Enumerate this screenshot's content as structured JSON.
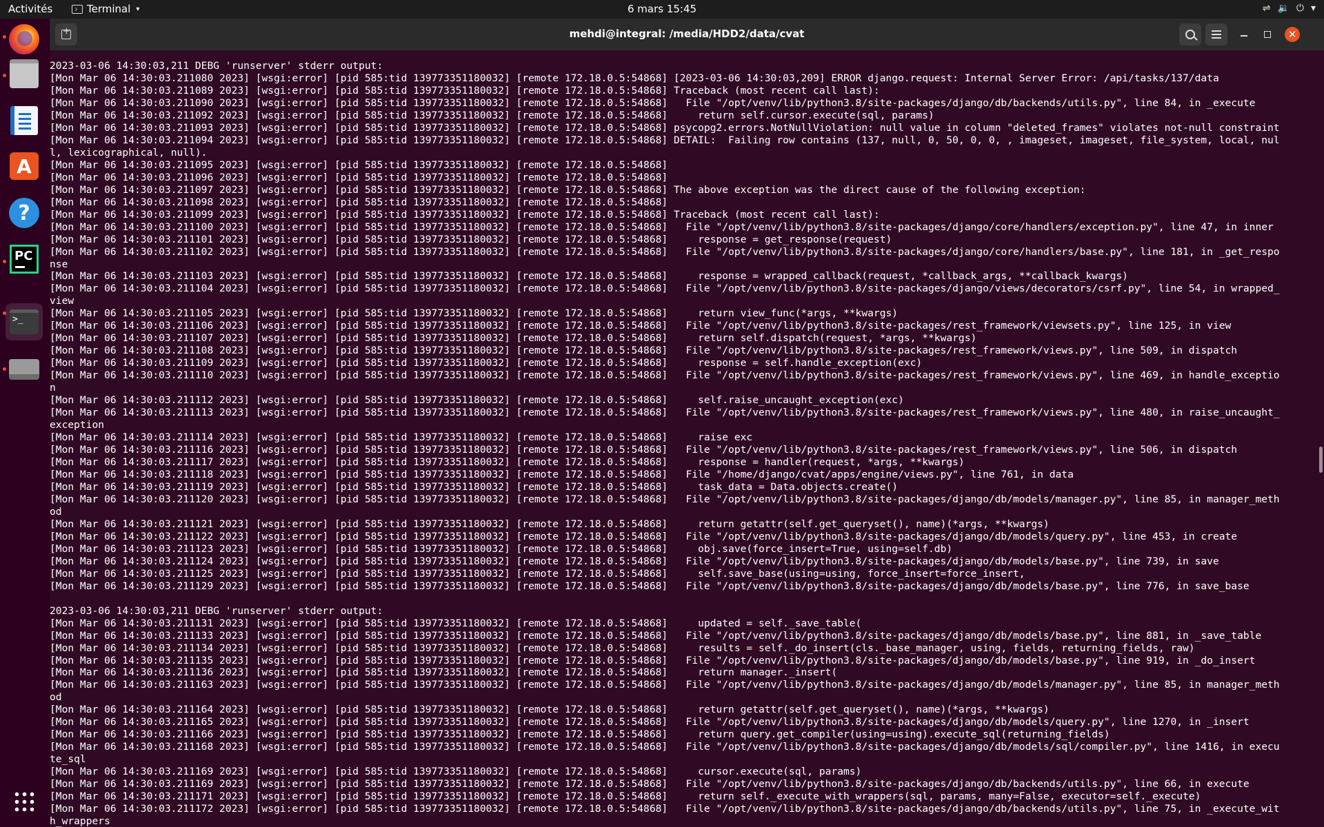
{
  "topbar": {
    "activities": "Activités",
    "app_name": "Terminal",
    "clock": "6 mars  15:45",
    "status_icons": [
      "network-icon",
      "volume-icon",
      "power-icon"
    ]
  },
  "dock": {
    "items": [
      "firefox",
      "files",
      "libreoffice-writer",
      "ubuntu-software",
      "help",
      "pycharm",
      "terminal",
      "drive",
      "show-applications"
    ]
  },
  "window": {
    "title": "mehdi@integral: /media/HDD2/data/cvat"
  },
  "terminal": {
    "lines": [
      "2023-03-06 14:30:03,211 DEBG 'runserver' stderr output:",
      "[Mon Mar 06 14:30:03.211080 2023] [wsgi:error] [pid 585:tid 139773351180032] [remote 172.18.0.5:54868] [2023-03-06 14:30:03,209] ERROR django.request: Internal Server Error: /api/tasks/137/data",
      "[Mon Mar 06 14:30:03.211089 2023] [wsgi:error] [pid 585:tid 139773351180032] [remote 172.18.0.5:54868] Traceback (most recent call last):",
      "[Mon Mar 06 14:30:03.211090 2023] [wsgi:error] [pid 585:tid 139773351180032] [remote 172.18.0.5:54868]   File \"/opt/venv/lib/python3.8/site-packages/django/db/backends/utils.py\", line 84, in _execute",
      "[Mon Mar 06 14:30:03.211092 2023] [wsgi:error] [pid 585:tid 139773351180032] [remote 172.18.0.5:54868]     return self.cursor.execute(sql, params)",
      "[Mon Mar 06 14:30:03.211093 2023] [wsgi:error] [pid 585:tid 139773351180032] [remote 172.18.0.5:54868] psycopg2.errors.NotNullViolation: null value in column \"deleted_frames\" violates not-null constraint",
      "[Mon Mar 06 14:30:03.211094 2023] [wsgi:error] [pid 585:tid 139773351180032] [remote 172.18.0.5:54868] DETAIL:  Failing row contains (137, null, 0, 50, 0, 0, , imageset, imageset, file_system, local, nul",
      "l, lexicographical, null).",
      "[Mon Mar 06 14:30:03.211095 2023] [wsgi:error] [pid 585:tid 139773351180032] [remote 172.18.0.5:54868]",
      "[Mon Mar 06 14:30:03.211096 2023] [wsgi:error] [pid 585:tid 139773351180032] [remote 172.18.0.5:54868]",
      "[Mon Mar 06 14:30:03.211097 2023] [wsgi:error] [pid 585:tid 139773351180032] [remote 172.18.0.5:54868] The above exception was the direct cause of the following exception:",
      "[Mon Mar 06 14:30:03.211098 2023] [wsgi:error] [pid 585:tid 139773351180032] [remote 172.18.0.5:54868]",
      "[Mon Mar 06 14:30:03.211099 2023] [wsgi:error] [pid 585:tid 139773351180032] [remote 172.18.0.5:54868] Traceback (most recent call last):",
      "[Mon Mar 06 14:30:03.211100 2023] [wsgi:error] [pid 585:tid 139773351180032] [remote 172.18.0.5:54868]   File \"/opt/venv/lib/python3.8/site-packages/django/core/handlers/exception.py\", line 47, in inner",
      "[Mon Mar 06 14:30:03.211101 2023] [wsgi:error] [pid 585:tid 139773351180032] [remote 172.18.0.5:54868]     response = get_response(request)",
      "[Mon Mar 06 14:30:03.211102 2023] [wsgi:error] [pid 585:tid 139773351180032] [remote 172.18.0.5:54868]   File \"/opt/venv/lib/python3.8/site-packages/django/core/handlers/base.py\", line 181, in _get_respo",
      "nse",
      "[Mon Mar 06 14:30:03.211103 2023] [wsgi:error] [pid 585:tid 139773351180032] [remote 172.18.0.5:54868]     response = wrapped_callback(request, *callback_args, **callback_kwargs)",
      "[Mon Mar 06 14:30:03.211104 2023] [wsgi:error] [pid 585:tid 139773351180032] [remote 172.18.0.5:54868]   File \"/opt/venv/lib/python3.8/site-packages/django/views/decorators/csrf.py\", line 54, in wrapped_",
      "view",
      "[Mon Mar 06 14:30:03.211105 2023] [wsgi:error] [pid 585:tid 139773351180032] [remote 172.18.0.5:54868]     return view_func(*args, **kwargs)",
      "[Mon Mar 06 14:30:03.211106 2023] [wsgi:error] [pid 585:tid 139773351180032] [remote 172.18.0.5:54868]   File \"/opt/venv/lib/python3.8/site-packages/rest_framework/viewsets.py\", line 125, in view",
      "[Mon Mar 06 14:30:03.211107 2023] [wsgi:error] [pid 585:tid 139773351180032] [remote 172.18.0.5:54868]     return self.dispatch(request, *args, **kwargs)",
      "[Mon Mar 06 14:30:03.211108 2023] [wsgi:error] [pid 585:tid 139773351180032] [remote 172.18.0.5:54868]   File \"/opt/venv/lib/python3.8/site-packages/rest_framework/views.py\", line 509, in dispatch",
      "[Mon Mar 06 14:30:03.211109 2023] [wsgi:error] [pid 585:tid 139773351180032] [remote 172.18.0.5:54868]     response = self.handle_exception(exc)",
      "[Mon Mar 06 14:30:03.211110 2023] [wsgi:error] [pid 585:tid 139773351180032] [remote 172.18.0.5:54868]   File \"/opt/venv/lib/python3.8/site-packages/rest_framework/views.py\", line 469, in handle_exceptio",
      "n",
      "[Mon Mar 06 14:30:03.211112 2023] [wsgi:error] [pid 585:tid 139773351180032] [remote 172.18.0.5:54868]     self.raise_uncaught_exception(exc)",
      "[Mon Mar 06 14:30:03.211113 2023] [wsgi:error] [pid 585:tid 139773351180032] [remote 172.18.0.5:54868]   File \"/opt/venv/lib/python3.8/site-packages/rest_framework/views.py\", line 480, in raise_uncaught_",
      "exception",
      "[Mon Mar 06 14:30:03.211114 2023] [wsgi:error] [pid 585:tid 139773351180032] [remote 172.18.0.5:54868]     raise exc",
      "[Mon Mar 06 14:30:03.211116 2023] [wsgi:error] [pid 585:tid 139773351180032] [remote 172.18.0.5:54868]   File \"/opt/venv/lib/python3.8/site-packages/rest_framework/views.py\", line 506, in dispatch",
      "[Mon Mar 06 14:30:03.211117 2023] [wsgi:error] [pid 585:tid 139773351180032] [remote 172.18.0.5:54868]     response = handler(request, *args, **kwargs)",
      "[Mon Mar 06 14:30:03.211118 2023] [wsgi:error] [pid 585:tid 139773351180032] [remote 172.18.0.5:54868]   File \"/home/django/cvat/apps/engine/views.py\", line 761, in data",
      "[Mon Mar 06 14:30:03.211119 2023] [wsgi:error] [pid 585:tid 139773351180032] [remote 172.18.0.5:54868]     task_data = Data.objects.create()",
      "[Mon Mar 06 14:30:03.211120 2023] [wsgi:error] [pid 585:tid 139773351180032] [remote 172.18.0.5:54868]   File \"/opt/venv/lib/python3.8/site-packages/django/db/models/manager.py\", line 85, in manager_meth",
      "od",
      "[Mon Mar 06 14:30:03.211121 2023] [wsgi:error] [pid 585:tid 139773351180032] [remote 172.18.0.5:54868]     return getattr(self.get_queryset(), name)(*args, **kwargs)",
      "[Mon Mar 06 14:30:03.211122 2023] [wsgi:error] [pid 585:tid 139773351180032] [remote 172.18.0.5:54868]   File \"/opt/venv/lib/python3.8/site-packages/django/db/models/query.py\", line 453, in create",
      "[Mon Mar 06 14:30:03.211123 2023] [wsgi:error] [pid 585:tid 139773351180032] [remote 172.18.0.5:54868]     obj.save(force_insert=True, using=self.db)",
      "[Mon Mar 06 14:30:03.211124 2023] [wsgi:error] [pid 585:tid 139773351180032] [remote 172.18.0.5:54868]   File \"/opt/venv/lib/python3.8/site-packages/django/db/models/base.py\", line 739, in save",
      "[Mon Mar 06 14:30:03.211125 2023] [wsgi:error] [pid 585:tid 139773351180032] [remote 172.18.0.5:54868]     self.save_base(using=using, force_insert=force_insert,",
      "[Mon Mar 06 14:30:03.211129 2023] [wsgi:error] [pid 585:tid 139773351180032] [remote 172.18.0.5:54868]   File \"/opt/venv/lib/python3.8/site-packages/django/db/models/base.py\", line 776, in save_base",
      "",
      "2023-03-06 14:30:03,211 DEBG 'runserver' stderr output:",
      "[Mon Mar 06 14:30:03.211131 2023] [wsgi:error] [pid 585:tid 139773351180032] [remote 172.18.0.5:54868]     updated = self._save_table(",
      "[Mon Mar 06 14:30:03.211133 2023] [wsgi:error] [pid 585:tid 139773351180032] [remote 172.18.0.5:54868]   File \"/opt/venv/lib/python3.8/site-packages/django/db/models/base.py\", line 881, in _save_table",
      "[Mon Mar 06 14:30:03.211134 2023] [wsgi:error] [pid 585:tid 139773351180032] [remote 172.18.0.5:54868]     results = self._do_insert(cls._base_manager, using, fields, returning_fields, raw)",
      "[Mon Mar 06 14:30:03.211135 2023] [wsgi:error] [pid 585:tid 139773351180032] [remote 172.18.0.5:54868]   File \"/opt/venv/lib/python3.8/site-packages/django/db/models/base.py\", line 919, in _do_insert",
      "[Mon Mar 06 14:30:03.211136 2023] [wsgi:error] [pid 585:tid 139773351180032] [remote 172.18.0.5:54868]     return manager._insert(",
      "[Mon Mar 06 14:30:03.211163 2023] [wsgi:error] [pid 585:tid 139773351180032] [remote 172.18.0.5:54868]   File \"/opt/venv/lib/python3.8/site-packages/django/db/models/manager.py\", line 85, in manager_meth",
      "od",
      "[Mon Mar 06 14:30:03.211164 2023] [wsgi:error] [pid 585:tid 139773351180032] [remote 172.18.0.5:54868]     return getattr(self.get_queryset(), name)(*args, **kwargs)",
      "[Mon Mar 06 14:30:03.211165 2023] [wsgi:error] [pid 585:tid 139773351180032] [remote 172.18.0.5:54868]   File \"/opt/venv/lib/python3.8/site-packages/django/db/models/query.py\", line 1270, in _insert",
      "[Mon Mar 06 14:30:03.211166 2023] [wsgi:error] [pid 585:tid 139773351180032] [remote 172.18.0.5:54868]     return query.get_compiler(using=using).execute_sql(returning_fields)",
      "[Mon Mar 06 14:30:03.211168 2023] [wsgi:error] [pid 585:tid 139773351180032] [remote 172.18.0.5:54868]   File \"/opt/venv/lib/python3.8/site-packages/django/db/models/sql/compiler.py\", line 1416, in execu",
      "te_sql",
      "[Mon Mar 06 14:30:03.211169 2023] [wsgi:error] [pid 585:tid 139773351180032] [remote 172.18.0.5:54868]     cursor.execute(sql, params)",
      "[Mon Mar 06 14:30:03.211169 2023] [wsgi:error] [pid 585:tid 139773351180032] [remote 172.18.0.5:54868]   File \"/opt/venv/lib/python3.8/site-packages/django/db/backends/utils.py\", line 66, in execute",
      "[Mon Mar 06 14:30:03.211171 2023] [wsgi:error] [pid 585:tid 139773351180032] [remote 172.18.0.5:54868]     return self._execute_with_wrappers(sql, params, many=False, executor=self._execute)",
      "[Mon Mar 06 14:30:03.211172 2023] [wsgi:error] [pid 585:tid 139773351180032] [remote 172.18.0.5:54868]   File \"/opt/venv/lib/python3.8/site-packages/django/db/backends/utils.py\", line 75, in _execute_wit",
      "h_wrappers"
    ]
  },
  "colors": {
    "terminal_bg": "#300a24",
    "terminal_fg": "#ffffff",
    "titlebar_bg": "#2b2b2b",
    "topbar_bg": "#1d1d1d",
    "dock_bg": "#2c001e",
    "accent": "#e95420"
  }
}
